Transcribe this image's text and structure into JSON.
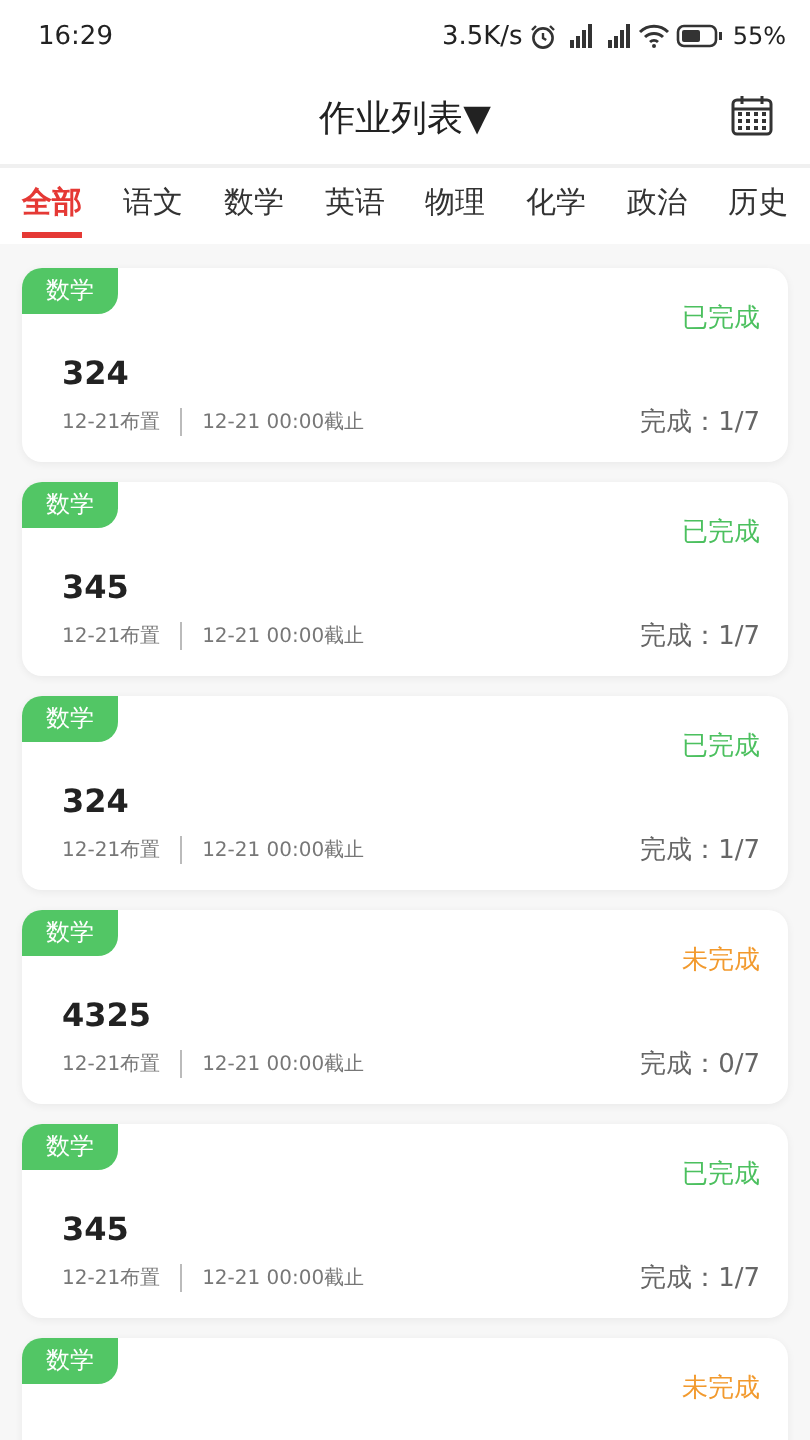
{
  "status_bar": {
    "time": "16:29",
    "speed": "3.5K/s",
    "battery": "55%"
  },
  "header": {
    "title": "作业列表▼"
  },
  "tabs": [
    {
      "label": "全部",
      "selected": true
    },
    {
      "label": "语文",
      "selected": false
    },
    {
      "label": "数学",
      "selected": false
    },
    {
      "label": "英语",
      "selected": false
    },
    {
      "label": "物理",
      "selected": false
    },
    {
      "label": "化学",
      "selected": false
    },
    {
      "label": "政治",
      "selected": false
    },
    {
      "label": "历史",
      "selected": false
    }
  ],
  "assignments": [
    {
      "subject": "数学",
      "status": {
        "kind": "done",
        "label": "已完成"
      },
      "title": "324",
      "assigned": "12-21布置",
      "deadline": "12-21 00:00截止",
      "progress": "完成：1/7"
    },
    {
      "subject": "数学",
      "status": {
        "kind": "done",
        "label": "已完成"
      },
      "title": "345",
      "assigned": "12-21布置",
      "deadline": "12-21 00:00截止",
      "progress": "完成：1/7"
    },
    {
      "subject": "数学",
      "status": {
        "kind": "done",
        "label": "已完成"
      },
      "title": "324",
      "assigned": "12-21布置",
      "deadline": "12-21 00:00截止",
      "progress": "完成：1/7"
    },
    {
      "subject": "数学",
      "status": {
        "kind": "pending",
        "label": "未完成"
      },
      "title": "4325",
      "assigned": "12-21布置",
      "deadline": "12-21 00:00截止",
      "progress": "完成：0/7"
    },
    {
      "subject": "数学",
      "status": {
        "kind": "done",
        "label": "已完成"
      },
      "title": "345",
      "assigned": "12-21布置",
      "deadline": "12-21 00:00截止",
      "progress": "完成：1/7"
    },
    {
      "subject": "数学",
      "status": {
        "kind": "pending",
        "label": "未完成"
      }
    }
  ]
}
